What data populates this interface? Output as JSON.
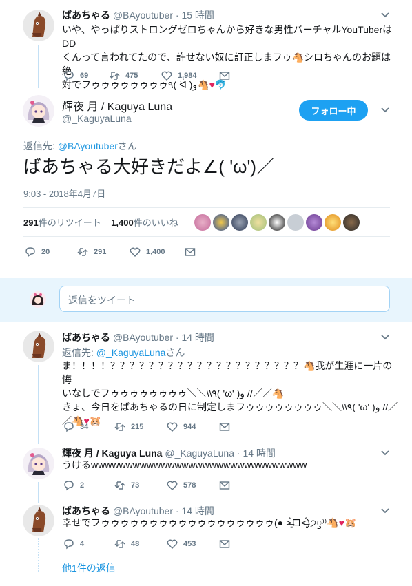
{
  "tweet1": {
    "name": "ばあちゃる",
    "handle": "@BAyoutuber",
    "time": "15 時間",
    "line1": "いや、やっぱりストロングゼロちゃんから好きな男性バーチャルYouTuberはDD",
    "line2": "くんって言われてたので、許せない奴に訂正しまフゥ",
    "line2b": "シロちゃんのお題は絶",
    "line3": "対でフゥゥゥゥゥゥゥゥ٩( ᐛ )و",
    "replies": "69",
    "retweets": "475",
    "likes": "1,984"
  },
  "main": {
    "name": "輝夜 月 / Kaguya Luna",
    "handle": "@_KaguyaLuna",
    "follow_label": "フォロー中",
    "reply_prefix": "返信先: ",
    "reply_target": "@BAyoutuber",
    "reply_suffix": "さん",
    "text": "ばあちゃる大好きだよ∠( 'ω')／",
    "timestamp": "9:03 - 2018年4月7日",
    "rt_count": "291",
    "rt_label": "件のリツイート",
    "like_count": "1,400",
    "like_label": "件のいいね",
    "replies": "20",
    "retweets": "291",
    "likes": "1,400"
  },
  "reply_box": {
    "placeholder": "返信をツイート"
  },
  "reply1": {
    "name": "ばあちゃる",
    "handle": "@BAyoutuber",
    "time": "14 時間",
    "reply_prefix": "返信先: ",
    "reply_target": "@_KaguyaLuna",
    "reply_suffix": "さん",
    "line1": "ま！！！！？？？？？？？？？？？？？？？？？？？？",
    "line1b": "我が生涯に一片の悔",
    "line2": "いなしでフゥゥゥゥゥゥゥゥ＼＼\\\\٩( 'ω' )و //／／",
    "line3": "きょ、今日をばあちゃるの日に制定しまフゥゥゥゥゥゥゥゥ＼＼\\\\٩( 'ω' )و //／",
    "line4": "／",
    "replies": "34",
    "retweets": "215",
    "likes": "944"
  },
  "reply2": {
    "name": "輝夜 月 / Kaguya Luna",
    "handle": "@_KaguyaLuna",
    "time": "14 時間",
    "text": "うけるwwwwwwwwwwwwwwwwwwwwwwwwwwwwwww",
    "replies": "2",
    "retweets": "73",
    "likes": "578"
  },
  "reply3": {
    "name": "ばあちゃる",
    "handle": "@BAyoutuber",
    "time": "14 時間",
    "text": "幸せでフゥゥゥゥゥゥゥゥゥゥゥゥゥゥゥゥゥゥ(● ˃̶͈̀ロ˂̶͈́)੭ꠥ⁾⁾",
    "replies": "4",
    "retweets": "48",
    "likes": "453"
  },
  "more_replies": "他1件の返信",
  "colors": {
    "accent": "#1da1f2",
    "like": "#e0245e",
    "thread": "#c4e0f5"
  }
}
